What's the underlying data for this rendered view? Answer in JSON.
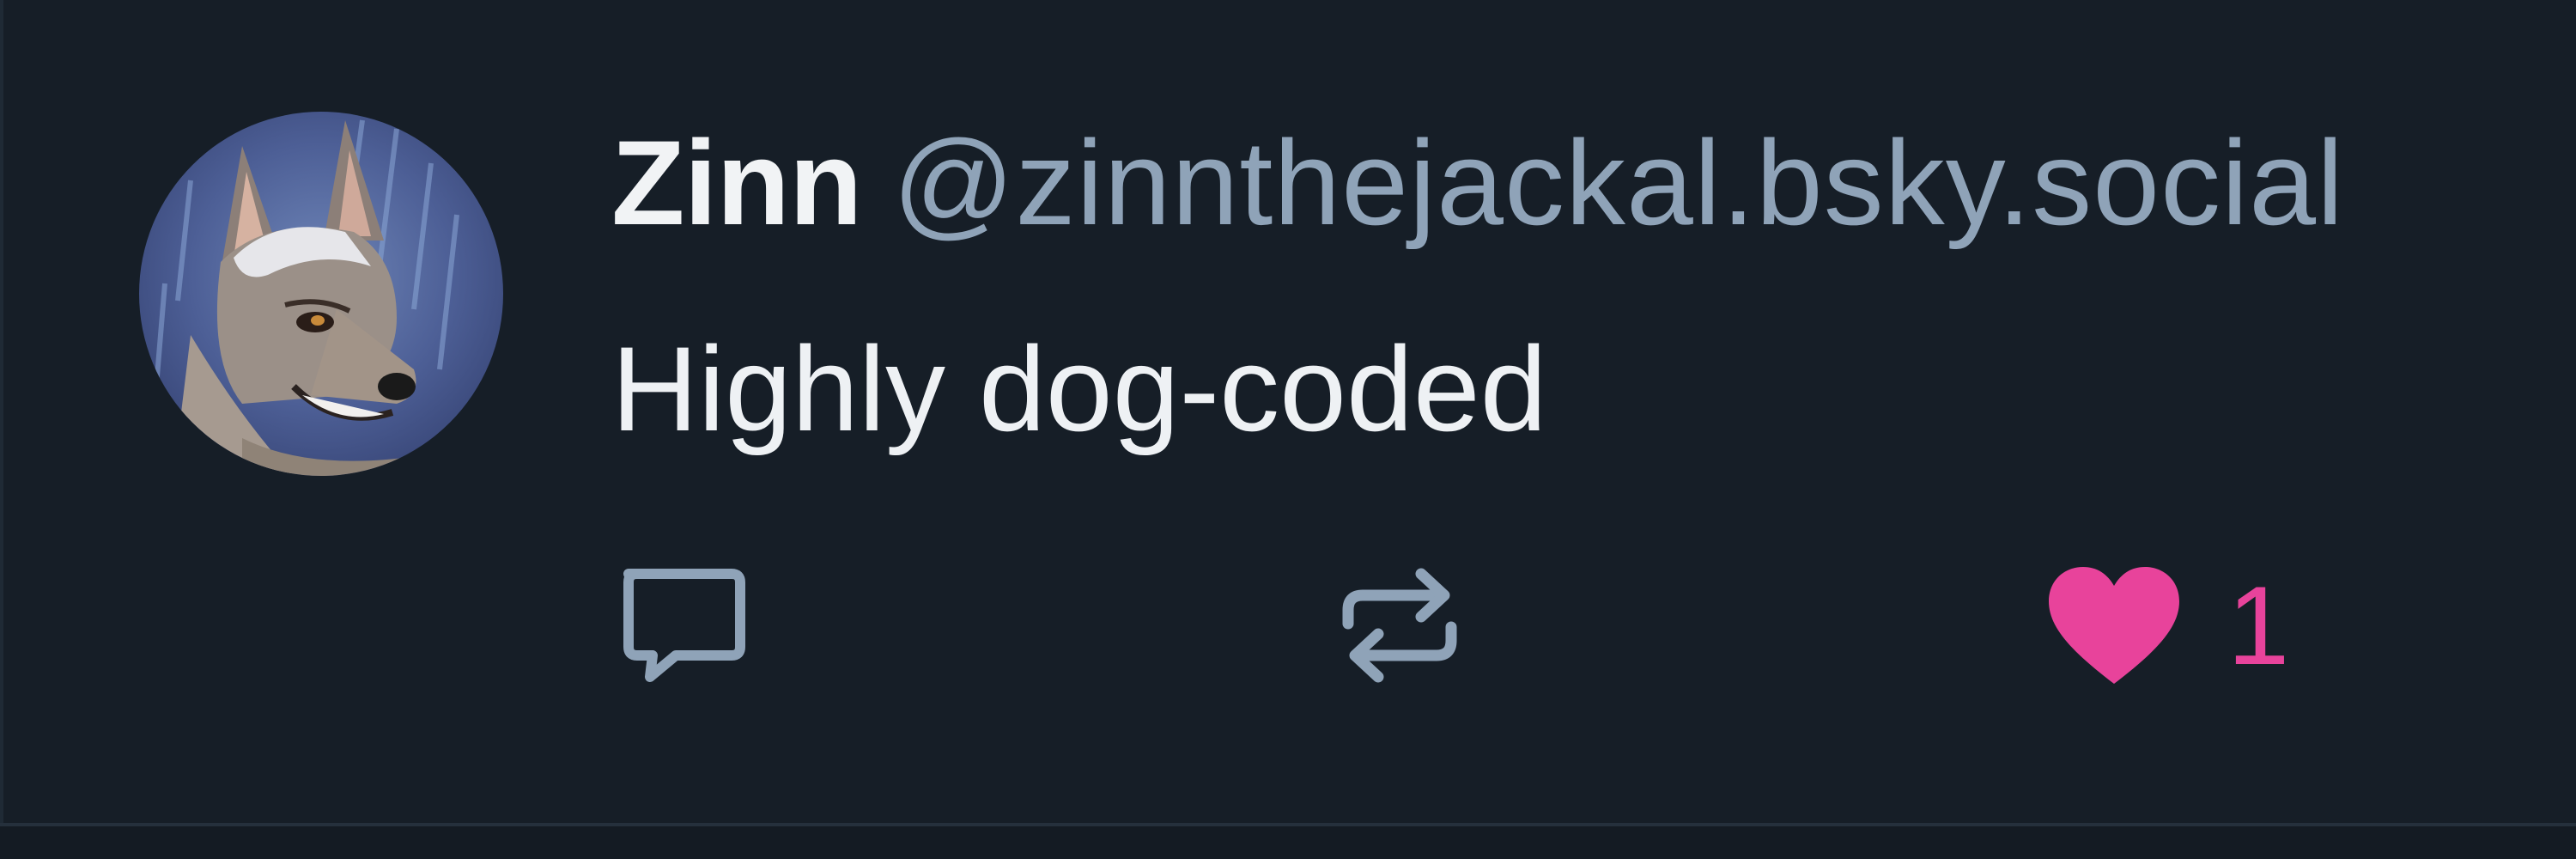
{
  "post": {
    "author": {
      "display_name": "Zinn",
      "handle": "@zinnthejackal.bsky.social"
    },
    "text": "Highly dog-coded",
    "actions": {
      "reply_icon": "speech-bubble-icon",
      "repost_icon": "repost-arrows-icon",
      "like_icon": "heart-icon",
      "like_count": "1",
      "liked": true
    }
  },
  "colors": {
    "background": "#161e27",
    "handle": "#8fa3b8",
    "icon": "#8fa3b8",
    "like_accent": "#e8439b",
    "text": "#eef1f4"
  }
}
